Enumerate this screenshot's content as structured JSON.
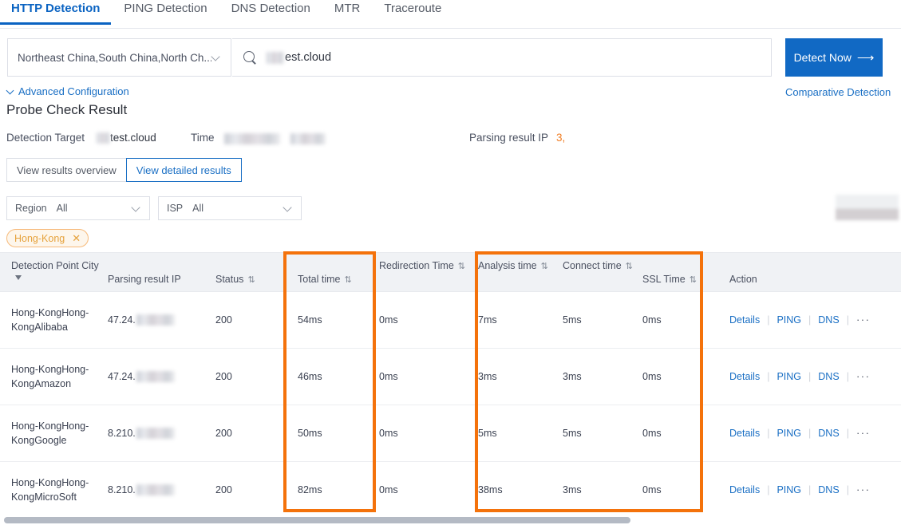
{
  "tabs": [
    {
      "label": "HTTP Detection",
      "active": true
    },
    {
      "label": "PING Detection",
      "active": false
    },
    {
      "label": "DNS Detection",
      "active": false
    },
    {
      "label": "MTR",
      "active": false
    },
    {
      "label": "Traceroute",
      "active": false
    }
  ],
  "search": {
    "region_value": "Northeast China,South China,North Ch...",
    "target_value": "est.cloud",
    "target_redacted_prefix": true,
    "detect_button": "Detect Now",
    "detect_arrow": "⟶",
    "comparative_link": "Comparative Detection",
    "search_icon": "search-icon"
  },
  "advanced": {
    "label": "Advanced Configuration",
    "icon": "chevron-down-icon"
  },
  "page_title": "Probe Check Result",
  "summary": {
    "target_label": "Detection Target",
    "target_value": "test.cloud",
    "time_label": "Time",
    "time_value_redacted": true,
    "parsing_label": "Parsing result IP",
    "parsing_value": "3,",
    "parsing_value_color": "#f07c22"
  },
  "view_toggle": [
    {
      "label": "View results overview",
      "active": false
    },
    {
      "label": "View detailed results",
      "active": true
    }
  ],
  "filters": [
    {
      "key": "Region",
      "value": "All",
      "icon": "chevron-down-icon"
    },
    {
      "key": "ISP",
      "value": "All",
      "icon": "chevron-down-icon"
    }
  ],
  "tags": [
    {
      "label": "Hong-Kong",
      "close_icon": "close-icon",
      "color": "#e6a23c"
    }
  ],
  "table": {
    "columns": [
      {
        "label": "Detection Point City",
        "sort": false,
        "filter": true
      },
      {
        "label": "Parsing result IP",
        "sort": false,
        "filter": false
      },
      {
        "label": "Status",
        "sort": true,
        "filter": false
      },
      {
        "label": "Total time",
        "sort": true,
        "filter": false
      },
      {
        "label": "Redirection Time",
        "sort": true,
        "filter": false
      },
      {
        "label": "Analysis time",
        "sort": true,
        "filter": false
      },
      {
        "label": "Connect time",
        "sort": true,
        "filter": false
      },
      {
        "label": "SSL Time",
        "sort": true,
        "filter": false
      },
      {
        "label": "Action",
        "sort": false,
        "filter": false
      }
    ],
    "sort_glyph": "⇅",
    "rows": [
      {
        "city": "Hong-KongHong-KongAlibaba",
        "ip": "47.24.",
        "ip_redacted": true,
        "status": "200",
        "total_time": "54ms",
        "redirection_time": "0ms",
        "analysis_time": "7ms",
        "connect_time": "5ms",
        "ssl_time": "0ms"
      },
      {
        "city": "Hong-KongHong-KongAmazon",
        "ip": "47.24.",
        "ip_redacted": true,
        "status": "200",
        "total_time": "46ms",
        "redirection_time": "0ms",
        "analysis_time": "3ms",
        "connect_time": "3ms",
        "ssl_time": "0ms"
      },
      {
        "city": "Hong-KongHong-KongGoogle",
        "ip": "8.210.",
        "ip_redacted": true,
        "status": "200",
        "total_time": "50ms",
        "redirection_time": "0ms",
        "analysis_time": "5ms",
        "connect_time": "5ms",
        "ssl_time": "0ms"
      },
      {
        "city": "Hong-KongHong-KongMicroSoft",
        "ip": "8.210.",
        "ip_redacted": true,
        "status": "200",
        "total_time": "82ms",
        "redirection_time": "0ms",
        "analysis_time": "38ms",
        "connect_time": "3ms",
        "ssl_time": "0ms"
      }
    ],
    "row_actions": {
      "details": "Details",
      "ping": "PING",
      "dns": "DNS",
      "more": "···"
    }
  },
  "annotations": [
    {
      "name": "total-time-highlight",
      "color": "#f4720b"
    },
    {
      "name": "phase-times-highlight",
      "color": "#f4720b"
    }
  ],
  "accent_blue": "#1169c4",
  "accent_orange": "#f4720b"
}
